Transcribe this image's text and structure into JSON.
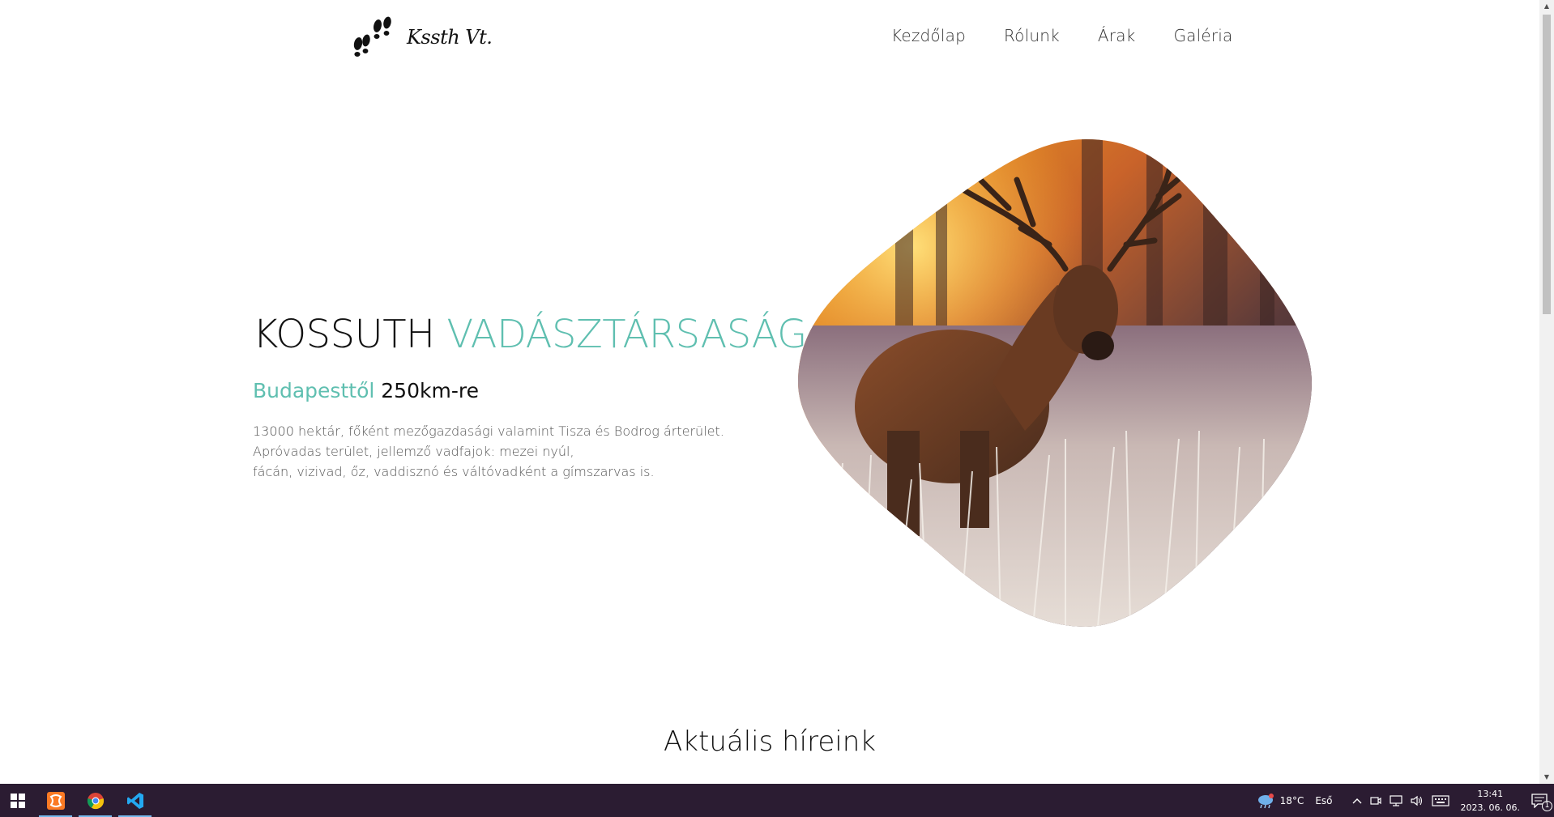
{
  "brand": {
    "logo_text": "Kssth Vt."
  },
  "nav": {
    "items": [
      "Kezdőlap",
      "Rólunk",
      "Árak",
      "Galéria"
    ]
  },
  "hero": {
    "title_main": "KOSSUTH",
    "title_accent": "VADÁSZTÁRSASÁG",
    "sub_accent": "Budapesttől",
    "sub_main": "250km-re",
    "desc_lines": [
      "13000 hektár, főként mezőgazdasági valamint Tisza és Bodrog árterület.",
      "Apróvadas terület, jellemző vadfajok: mezei nyúl,",
      "fácán, vizivad, őz, vaddisznó és váltóvadként a gímszarvas is."
    ],
    "image_icon": "deer-photo"
  },
  "news": {
    "title": "Aktuális híreink"
  },
  "colors": {
    "accent": "#5fbfb0",
    "taskbar": "#2b1c32"
  },
  "taskbar": {
    "apps": [
      "windows-start-icon",
      "xampp-icon",
      "chrome-icon",
      "vscode-icon"
    ],
    "weather_temp": "18°C",
    "weather_desc": "Eső",
    "time": "13:41",
    "date": "2023. 06. 06.",
    "notification_count": "1"
  }
}
